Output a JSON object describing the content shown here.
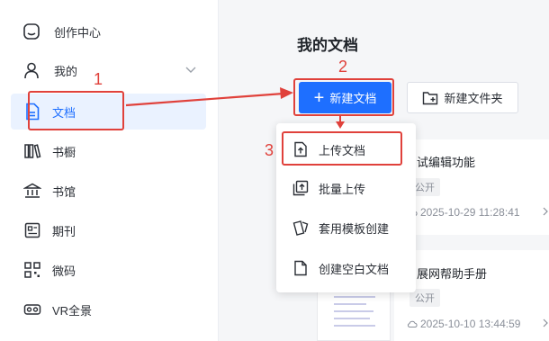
{
  "sidebar": {
    "create_center": "创作中心",
    "mine": "我的",
    "items": [
      {
        "label": "文档",
        "icon": "document-icon",
        "active": true
      },
      {
        "label": "书橱",
        "icon": "bookshelf-icon"
      },
      {
        "label": "书馆",
        "icon": "library-icon"
      },
      {
        "label": "期刊",
        "icon": "journal-icon"
      },
      {
        "label": "微码",
        "icon": "qrcode-icon"
      },
      {
        "label": "VR全景",
        "icon": "vr-icon"
      }
    ]
  },
  "main": {
    "title": "我的文档",
    "new_doc_button": "新建文档",
    "new_folder_button": "新建文件夹"
  },
  "dropdown": {
    "items": [
      {
        "label": "上传文档",
        "icon": "upload-doc-icon"
      },
      {
        "label": "批量上传",
        "icon": "batch-upload-icon"
      },
      {
        "label": "套用模板创建",
        "icon": "template-icon"
      },
      {
        "label": "创建空白文档",
        "icon": "blank-doc-icon"
      }
    ]
  },
  "documents": [
    {
      "title_fragment": "试编辑功能",
      "visibility": "公开",
      "timestamp": "2025-10-29 11:28:41"
    },
    {
      "title_fragment": "展网帮助手册",
      "visibility": "公开",
      "timestamp": "2025-10-10 13:44:59"
    }
  ],
  "annotations": {
    "step1": "1",
    "step2": "2",
    "step3": "3"
  },
  "colors": {
    "accent": "#1e6fff",
    "annotation": "#e0413b",
    "active_bg": "#eaf2ff"
  }
}
